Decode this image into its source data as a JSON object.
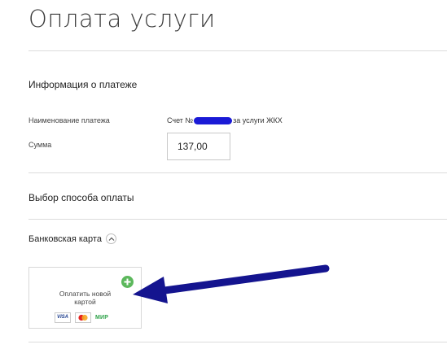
{
  "page": {
    "title": "Оплата услуги"
  },
  "payment_info": {
    "heading": "Информация о платеже",
    "name_label": "Наименование платежа",
    "name_prefix": "Счет №",
    "name_suffix": "за услуги ЖКХ",
    "amount_label": "Сумма",
    "amount_value": "137,00"
  },
  "payment_method": {
    "heading": "Выбор способа оплаты",
    "bank_card_label": "Банковская карта",
    "new_card_label": "Оплатить новой картой",
    "card_logos": [
      "VISA",
      "mastercard",
      "МИР"
    ]
  },
  "colors": {
    "redaction": "#1a1ad6",
    "annotation_arrow": "#14148f",
    "plus_badge": "#5cb85c",
    "mir_logo": "#2fa34a"
  },
  "icons": {
    "expand_toggle": "chevron-up-icon",
    "add_card": "plus-icon"
  }
}
